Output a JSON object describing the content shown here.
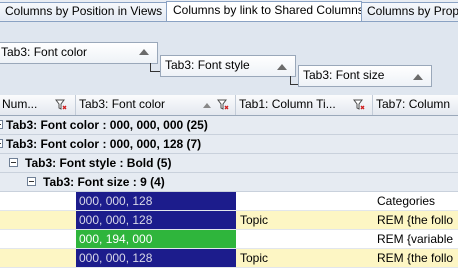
{
  "tabs": [
    {
      "label": "Columns by Position in Views"
    },
    {
      "label": "Columns by link to Shared Columns"
    },
    {
      "label": "Columns by Prope"
    }
  ],
  "group_panel": {
    "levels": [
      {
        "label": "Tab3: Font color"
      },
      {
        "label": "Tab3: Font style"
      },
      {
        "label": "Tab3: Font size"
      }
    ]
  },
  "columns": [
    {
      "label": "Num..."
    },
    {
      "label": "Tab3: Font color"
    },
    {
      "label": "Tab1: Column Ti..."
    },
    {
      "label": "Tab7: Column"
    }
  ],
  "groups": [
    {
      "label": "Tab3: Font color : 000, 000, 000 (25)"
    },
    {
      "label": "Tab3: Font color : 000, 000, 128 (7)"
    },
    {
      "label": "Tab3: Font style : Bold (5)"
    },
    {
      "label": "Tab3: Font size : 9 (4)"
    }
  ],
  "rows": [
    {
      "color_value": "000, 000, 128",
      "swatch": "#1c1c8c",
      "topic": "",
      "col4": "Categories",
      "selected": false
    },
    {
      "color_value": "000, 000, 128",
      "swatch": "#1c1c8c",
      "topic": "Topic",
      "col4": "REM {the follo",
      "selected": true
    },
    {
      "color_value": "000, 194, 000",
      "swatch": "#2fb53c",
      "topic": "",
      "col4": "REM {variable",
      "selected": false
    },
    {
      "color_value": "000, 000, 128",
      "swatch": "#1c1c8c",
      "topic": "Topic",
      "col4": "REM {the follo",
      "selected": true
    }
  ],
  "colors": {
    "accent_border": "#8aa2c3",
    "selected_row": "#fdf6c4",
    "group_row": "#e6ebf2"
  }
}
